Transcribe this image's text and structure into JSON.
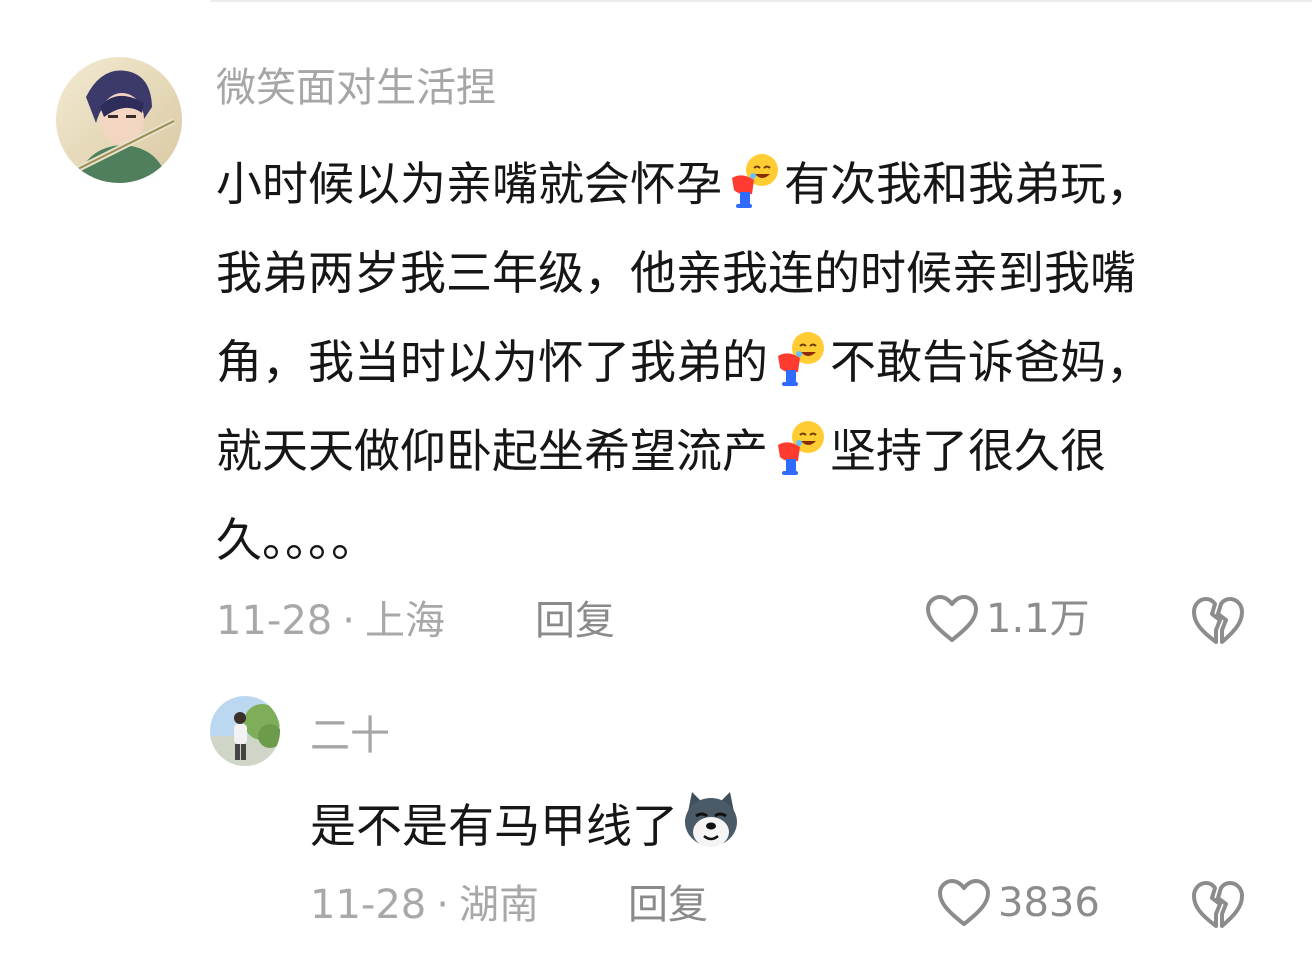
{
  "comments": [
    {
      "username": "微笑面对生活捏",
      "lines": [
        [
          "小时候以为亲嘴就会怀孕",
          "有次我和我弟玩，"
        ],
        [
          "我弟两岁我三年级，他亲我连的时候亲到我嘴"
        ],
        [
          "角，我当时以为怀了我弟的",
          "不敢告诉爸妈，"
        ],
        [
          "就天天做仰卧起坐希望流产",
          "坚持了很久很"
        ],
        [
          "久。。。。"
        ]
      ],
      "date": "11-28",
      "location": "上海",
      "reply_label": "回复",
      "likes": "1.1万",
      "emoji": "bowing-laugh-emoji"
    },
    {
      "username": "二十",
      "text": "是不是有马甲线了",
      "date": "11-28",
      "location": "湖南",
      "reply_label": "回复",
      "likes": "3836",
      "emoji": "shiba-doge-emoji"
    }
  ],
  "separator": "·",
  "icons": {
    "like": "heart-outline-icon",
    "dislike": "broken-heart-icon"
  },
  "colors": {
    "text": "#161616",
    "muted": "#a6a6a6",
    "icon": "#8c8c8c"
  }
}
